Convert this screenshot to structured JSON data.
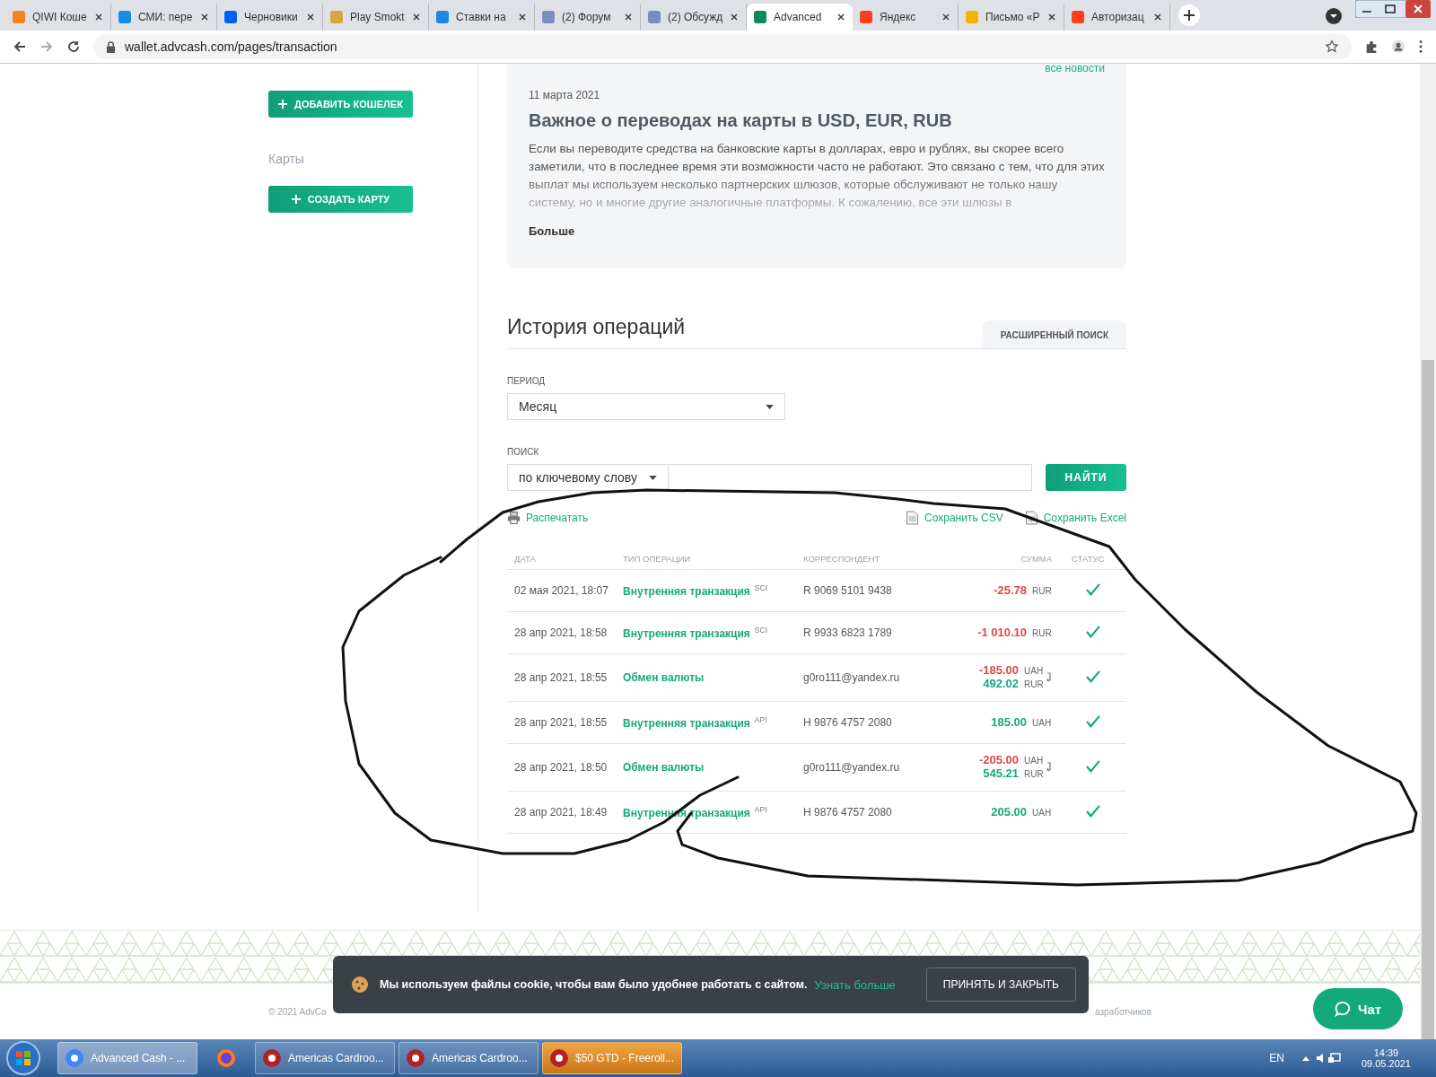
{
  "browser": {
    "tabs": [
      {
        "title": "QIWI Коше",
        "color": "#f58220",
        "selected": false
      },
      {
        "title": "СМИ: пере",
        "color": "#168de2",
        "selected": false
      },
      {
        "title": "Черновики",
        "color": "#005ff9",
        "selected": false
      },
      {
        "title": "Play Smokt",
        "color": "#d9a441",
        "selected": false
      },
      {
        "title": "Ставки на",
        "color": "#1e88e5",
        "selected": false
      },
      {
        "title": "(2) Форум",
        "color": "#7a8cc2",
        "selected": false
      },
      {
        "title": "(2) Обсужд",
        "color": "#7a8cc2",
        "selected": false
      },
      {
        "title": "Advanced",
        "color": "#0b8a5e",
        "selected": true
      },
      {
        "title": "Яндекс",
        "color": "#fc3f1d",
        "selected": false
      },
      {
        "title": "Письмо «Р",
        "color": "#f5b400",
        "selected": false
      },
      {
        "title": "Авторизац",
        "color": "#fc3f1d",
        "selected": false
      }
    ],
    "url": "wallet.advcash.com/pages/transaction"
  },
  "sidebar": {
    "add_wallet_button": "ДОБАВИТЬ КОШЕЛЕК",
    "cards_heading": "Карты",
    "create_card_button": "СОЗДАТЬ КАРТУ"
  },
  "news": {
    "all_news_link": "все новости",
    "date": "11 марта 2021",
    "title": "Важное о переводах на карты в USD, EUR, RUB",
    "body": "Если вы переводите средства на банковские карты в долларах, евро и рублях, вы скорее всего заметили, что в последнее время эти возможности часто не работают. Это связано с тем, что для этих выплат мы используем несколько партнерских шлюзов, которые обслуживают не только нашу систему, но и многие другие аналогичные платформы. К сожалению, все эти шлюзы в",
    "more_link": "Больше"
  },
  "history": {
    "title": "История операций",
    "advanced_search_tab": "РАСШИРЕННЫЙ ПОИСК",
    "period_label": "ПЕРИОД",
    "period_value": "Месяц",
    "search_label": "ПОИСК",
    "search_type": "по ключевому слову",
    "search_button": "НАЙТИ",
    "print_link": "Распечатать",
    "csv_link": "Сохранить CSV",
    "excel_link": "Сохранить Excel",
    "columns": [
      "ДАТА",
      "ТИП ОПЕРАЦИИ",
      "КОРРЕСПОНДЕНТ",
      "СУММА",
      "СТАТУС"
    ],
    "rows": [
      {
        "date": "02 мая 2021, 18:07",
        "type": "Внутренняя транзакция",
        "tag": "SCI",
        "correspondent": "R 9069 5101 9438",
        "amounts": [
          {
            "kind": "debit",
            "value": "-25.78",
            "currency": "RUR"
          }
        ]
      },
      {
        "date": "28 апр 2021, 18:58",
        "type": "Внутренняя транзакция",
        "tag": "SCI",
        "correspondent": "R 9933 6823 1789",
        "amounts": [
          {
            "kind": "debit",
            "value": "-1 010.10",
            "currency": "RUR"
          }
        ]
      },
      {
        "date": "28 апр 2021, 18:55",
        "type": "Обмен валюты",
        "correspondent": "g0ro111@yandex.ru",
        "amounts": [
          {
            "kind": "debit",
            "value": "-185.00",
            "currency": "UAH"
          },
          {
            "kind": "credit",
            "value": "492.02",
            "currency": "RUR"
          }
        ]
      },
      {
        "date": "28 апр 2021, 18:55",
        "type": "Внутренняя транзакция",
        "tag": "API",
        "correspondent": "H 9876 4757 2080",
        "amounts": [
          {
            "kind": "credit",
            "value": "185.00",
            "currency": "UAH"
          }
        ]
      },
      {
        "date": "28 апр 2021, 18:50",
        "type": "Обмен валюты",
        "correspondent": "g0ro111@yandex.ru",
        "amounts": [
          {
            "kind": "debit",
            "value": "-205.00",
            "currency": "UAH"
          },
          {
            "kind": "credit",
            "value": "545.21",
            "currency": "RUR"
          }
        ]
      },
      {
        "date": "28 апр 2021, 18:49",
        "type": "Внутренняя транзакция",
        "tag": "API",
        "correspondent": "H 9876 4757 2080",
        "amounts": [
          {
            "kind": "credit",
            "value": "205.00",
            "currency": "UAH"
          }
        ]
      }
    ]
  },
  "footer": {
    "copyright": "© 2021 AdvCa",
    "developers_link": "азработчиков"
  },
  "cookie_banner": {
    "text": "Мы используем файлы cookie, чтобы вам было удобнее работать с сайтом.",
    "link": "Узнать больше",
    "button": "ПРИНЯТЬ И ЗАКРЫТЬ"
  },
  "chat_button": "Чат",
  "taskbar": {
    "items": [
      {
        "kind": "window",
        "title": "Advanced Cash - ...",
        "selected": true
      },
      {
        "kind": "pinned",
        "selected": false
      },
      {
        "kind": "window",
        "title": "Americas Cardroo...",
        "selected": false
      },
      {
        "kind": "window",
        "title": "Americas Cardroo...",
        "selected": false
      },
      {
        "kind": "alert",
        "title": "$50 GTD - Freeroll...",
        "selected": false
      }
    ],
    "language": "EN",
    "time": "14:39",
    "date": "09.05.2021"
  }
}
